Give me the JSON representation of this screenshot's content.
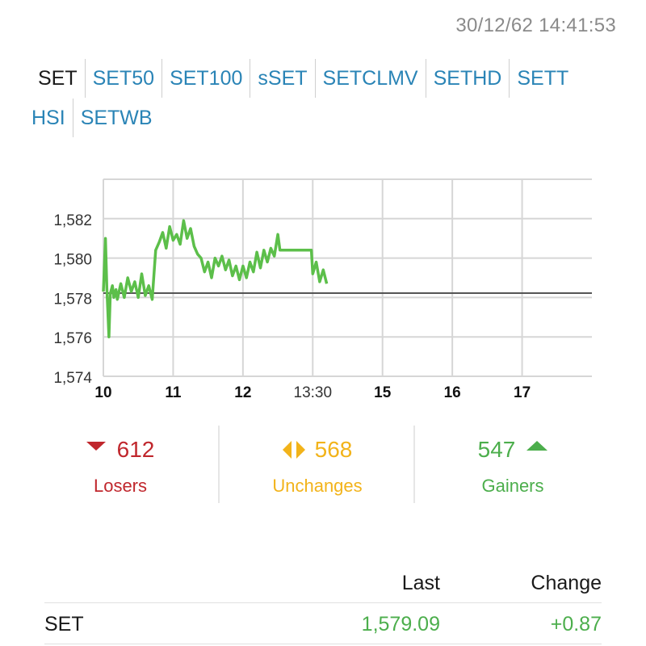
{
  "timestamp": "30/12/62 14:41:53",
  "tabs_row1": [
    "SET",
    "SET50",
    "SET100",
    "sSET",
    "SETCLMV",
    "SETHD",
    "SETT"
  ],
  "tabs_row2": [
    "HSI",
    "SETWB"
  ],
  "active_tab": "SET",
  "chart_data": {
    "type": "line",
    "title": "",
    "xlabel": "",
    "ylabel": "",
    "x_ticks": [
      "10",
      "11",
      "12",
      "13:30",
      "15",
      "16",
      "17"
    ],
    "y_ticks": [
      "1,574",
      "1,576",
      "1,578",
      "1,580",
      "1,582"
    ],
    "ylim": [
      1574,
      1584
    ],
    "xlim": [
      10,
      17
    ],
    "reference_line": 1578.22,
    "colors": {
      "line": "#5cbf4a",
      "reference": "#555555",
      "grid": "#d6d6d6"
    },
    "series": [
      {
        "x": [
          10.0,
          10.03,
          10.05,
          10.08,
          10.1,
          10.13,
          10.15,
          10.18,
          10.2,
          10.25,
          10.3,
          10.35,
          10.4,
          10.45,
          10.5,
          10.55,
          10.6,
          10.65,
          10.7,
          10.72,
          10.75,
          10.8,
          10.85,
          10.9,
          10.95,
          11.0,
          11.05,
          11.1,
          11.15,
          11.2,
          11.25,
          11.3,
          11.35,
          11.4,
          11.45,
          11.5,
          11.55,
          11.6,
          11.65,
          11.7,
          11.75,
          11.8,
          11.85,
          11.9,
          11.95,
          12.0,
          12.05,
          12.1,
          12.15,
          12.2,
          12.25,
          12.3,
          12.35,
          12.4,
          12.45,
          12.5,
          12.53,
          12.8,
          12.98,
          13.0,
          13.05,
          13.1,
          13.15,
          13.2
        ],
        "y": [
          1578.3,
          1581.0,
          1578.5,
          1576.0,
          1578.2,
          1578.6,
          1578.0,
          1578.4,
          1577.9,
          1578.7,
          1578.0,
          1579.0,
          1578.3,
          1578.8,
          1578.0,
          1579.2,
          1578.1,
          1578.6,
          1577.9,
          1578.9,
          1580.4,
          1580.8,
          1581.3,
          1580.5,
          1581.6,
          1580.9,
          1581.2,
          1580.7,
          1581.9,
          1581.0,
          1581.5,
          1580.6,
          1580.2,
          1580.0,
          1579.3,
          1579.8,
          1579.0,
          1580.0,
          1579.6,
          1580.1,
          1579.4,
          1579.9,
          1579.1,
          1579.6,
          1578.9,
          1579.6,
          1579.0,
          1579.8,
          1579.3,
          1580.3,
          1579.5,
          1580.4,
          1579.8,
          1580.5,
          1580.1,
          1581.2,
          1580.4,
          1580.4,
          1580.4,
          1579.2,
          1579.8,
          1578.8,
          1579.4,
          1578.7
        ]
      }
    ]
  },
  "stats": {
    "losers": {
      "value": "612",
      "label": "Losers"
    },
    "unchanges": {
      "value": "568",
      "label": "Unchanges"
    },
    "gainers": {
      "value": "547",
      "label": "Gainers"
    }
  },
  "table": {
    "headers": {
      "last": "Last",
      "change": "Change"
    },
    "rows": [
      {
        "name": "SET",
        "last": "1,579.09",
        "change": "+0.87"
      }
    ]
  }
}
